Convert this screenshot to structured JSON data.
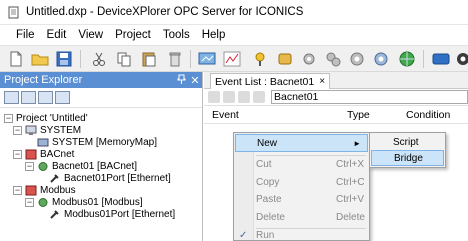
{
  "window": {
    "title": "Untitled.dxp - DeviceXPlorer OPC Server for ICONICS"
  },
  "menubar": {
    "items": [
      "File",
      "Edit",
      "View",
      "Project",
      "Tools",
      "Help"
    ]
  },
  "project_explorer": {
    "title": "Project Explorer",
    "tree": [
      {
        "label": "Project 'Untitled'"
      },
      {
        "label": "SYSTEM"
      },
      {
        "label": "SYSTEM [MemoryMap]"
      },
      {
        "label": "BACnet"
      },
      {
        "label": "Bacnet01 [BACnet]"
      },
      {
        "label": "Bacnet01Port [Ethernet]"
      },
      {
        "label": "Modbus"
      },
      {
        "label": "Modbus01 [Modbus]"
      },
      {
        "label": "Modbus01Port [Ethernet]"
      }
    ]
  },
  "event_list": {
    "tab_label": "Event List : Bacnet01",
    "tab_close": "×",
    "address_value": "Bacnet01",
    "columns": [
      "Event",
      "Type",
      "Condition"
    ]
  },
  "context_menu": {
    "items": [
      {
        "label": "New",
        "shortcut": "",
        "arrow": "►"
      },
      {
        "label": "Cut",
        "shortcut": "Ctrl+X"
      },
      {
        "label": "Copy",
        "shortcut": "Ctrl+C"
      },
      {
        "label": "Paste",
        "shortcut": "Ctrl+V"
      },
      {
        "label": "Delete",
        "shortcut": "Delete"
      },
      {
        "label": "Run",
        "shortcut": "",
        "check": "✓"
      }
    ]
  },
  "submenu": {
    "items": [
      {
        "label": "Script"
      },
      {
        "label": "Bridge"
      }
    ]
  },
  "colors": {
    "accent": "#5b8fd4",
    "highlight": "#cce4f7",
    "highlight_border": "#7eb4ea"
  }
}
